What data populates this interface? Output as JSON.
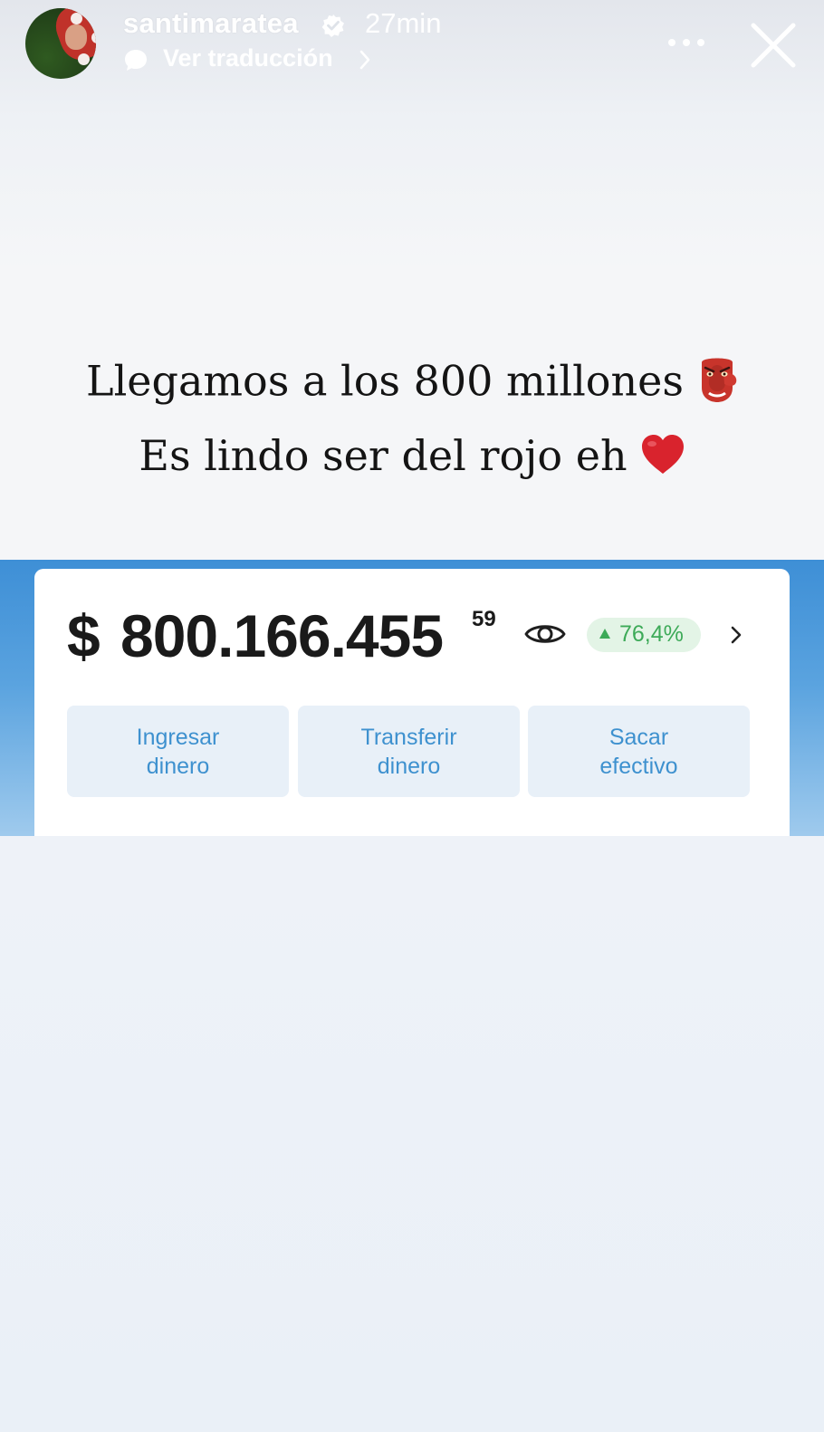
{
  "story_header": {
    "username": "santimaratea",
    "time_ago": "27min",
    "translate_label": "Ver traducción",
    "icons": [
      "verified-badge-icon",
      "translate-bubble-icon",
      "chevron-right-icon",
      "more-options-icon",
      "close-icon"
    ]
  },
  "caption": {
    "line1": "Llegamos a los 800 millones",
    "line1_emoji": "goblin-mask-emoji",
    "line2": "Es lindo ser del rojo eh",
    "line2_emoji": "red-heart-emoji"
  },
  "wallet": {
    "currency": "$",
    "amount": "800.166.455",
    "cents": "59",
    "change": "76,4%",
    "change_direction": "up",
    "actions": [
      {
        "line1": "Ingresar",
        "line2": "dinero"
      },
      {
        "line1": "Transferir",
        "line2": "dinero"
      },
      {
        "line1": "Sacar",
        "line2": "efectivo"
      }
    ],
    "colors": {
      "header_blue": "#3e8fd6",
      "button_text": "#3e91cf",
      "button_bg": "#e8f0f8",
      "positive_green": "#3daa58",
      "positive_bg": "#e3f4e6"
    }
  }
}
